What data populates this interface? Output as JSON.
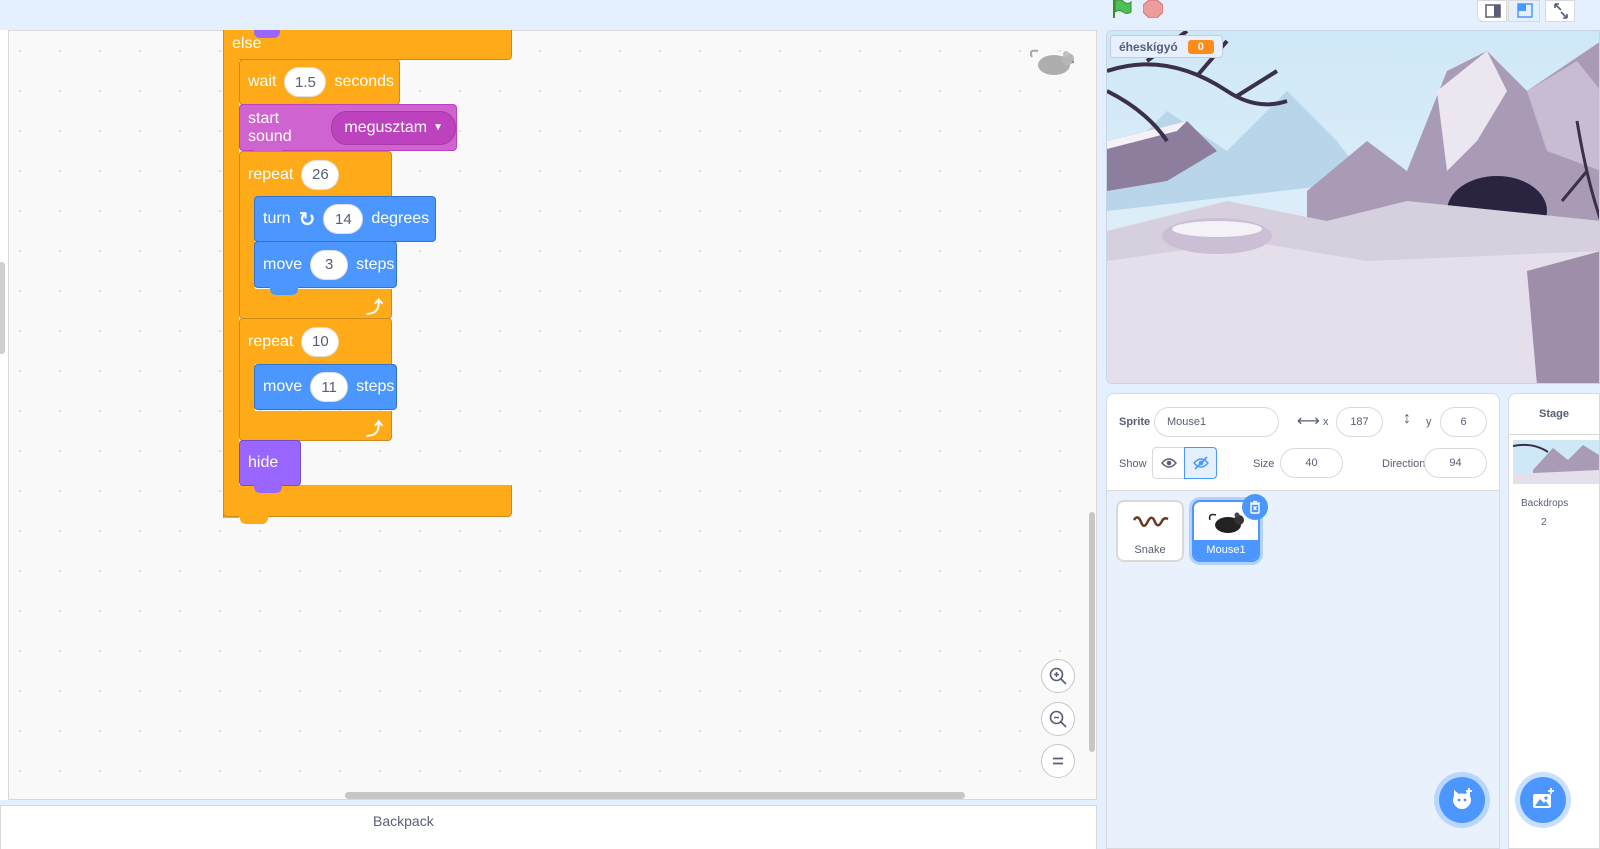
{
  "colors": {
    "control": "#ffab19",
    "sound": "#cf63cf",
    "motion": "#4c97ff",
    "looks": "#9966ff",
    "accent": "#4c97ff",
    "variable": "#ff8c1a"
  },
  "script": {
    "else_label": "else",
    "wait": {
      "label": "wait",
      "value": "1.5",
      "unit": "seconds"
    },
    "start_sound": {
      "label": "start sound",
      "value": "megusztam"
    },
    "repeat1": {
      "label": "repeat",
      "value": "26"
    },
    "turn": {
      "label": "turn",
      "value": "14",
      "unit": "degrees",
      "icon": "rotate-right-icon"
    },
    "move1": {
      "label": "move",
      "value": "3",
      "unit": "steps"
    },
    "repeat2": {
      "label": "repeat",
      "value": "10"
    },
    "move2": {
      "label": "move",
      "value": "11",
      "unit": "steps"
    },
    "hide": {
      "label": "hide"
    }
  },
  "backpack": {
    "label": "Backpack"
  },
  "stage": {
    "variable_name": "éheskígyó",
    "variable_value": "0"
  },
  "sprite_info": {
    "sprite_label": "Sprite",
    "sprite_name": "Mouse1",
    "x_label": "x",
    "x_value": "187",
    "y_label": "y",
    "y_value": "6",
    "show_label": "Show",
    "size_label": "Size",
    "size_value": "40",
    "direction_label": "Direction",
    "direction_value": "94"
  },
  "sprites": [
    {
      "name": "Snake"
    },
    {
      "name": "Mouse1"
    }
  ],
  "stage_pane": {
    "title": "Stage",
    "backdrops_label": "Backdrops",
    "backdrops_count": "2"
  }
}
